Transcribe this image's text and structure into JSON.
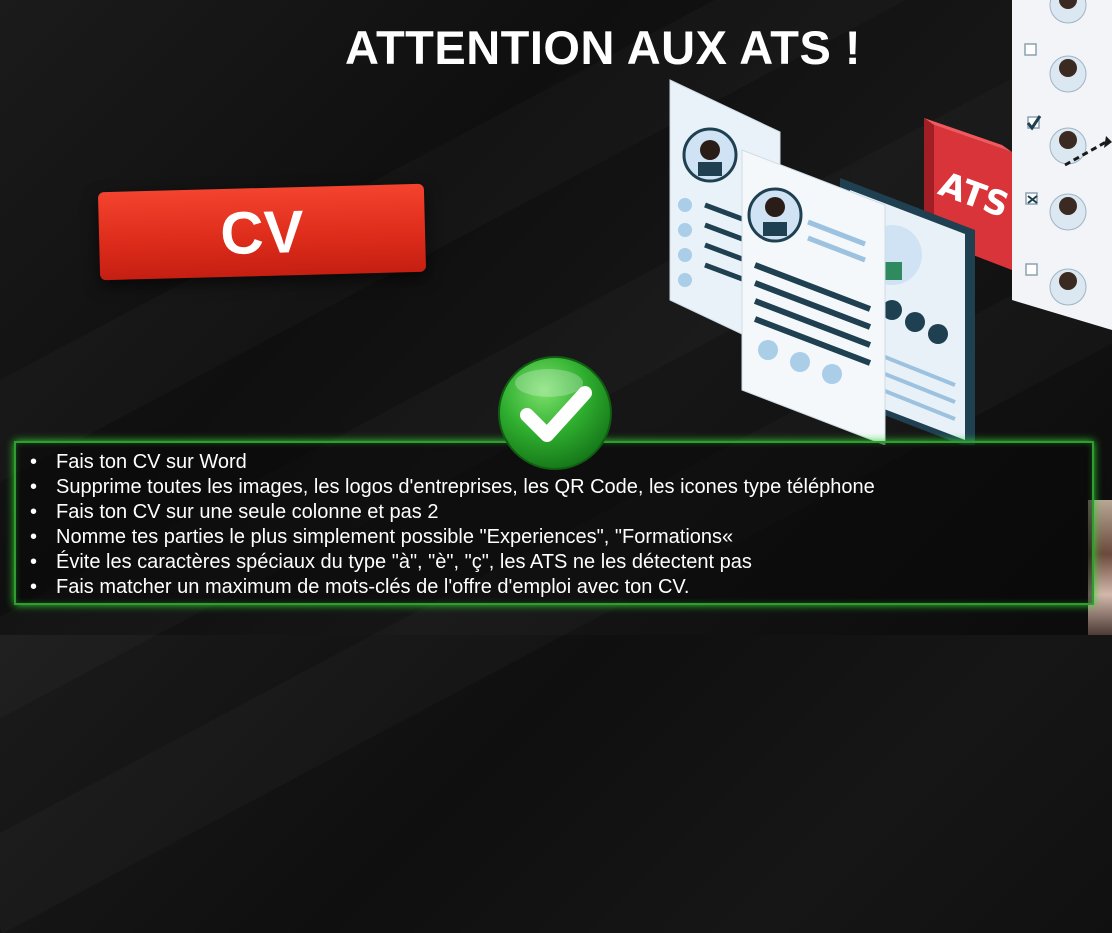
{
  "title": "ATTENTION AUX ATS !",
  "cv_badge": "CV",
  "ats_label": "ATS",
  "tips": [
    "Fais ton CV sur Word",
    "Supprime toutes les images, les logos d'entreprises, les QR Code, les icones type téléphone",
    "Fais ton CV sur une seule colonne et pas 2",
    "Nomme tes parties le plus simplement possible \"Experiences\", \"Formations«",
    "Évite les caractères spéciaux du type \"à\", \"è\", \"ç\", les ATS ne les détectent pas",
    "Fais matcher un maximum de mots-clés de l'offre d'emploi avec ton CV."
  ],
  "colors": {
    "badge_red": "#e0301e",
    "check_green": "#2fae2f",
    "frame_green": "#32d232",
    "ats_red": "#d9343a",
    "resume_blue": "#cfe3f4",
    "resume_dark": "#1f4050"
  },
  "icons": {
    "check": "check-circle-icon",
    "ats": "ats-box-icon"
  }
}
